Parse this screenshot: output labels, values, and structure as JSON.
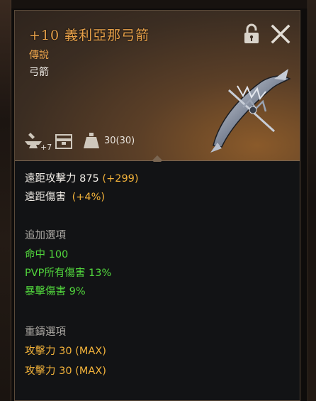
{
  "tooltip": {
    "item_name": "+10  義利亞那弓箭",
    "grade": "傳說",
    "item_type": "弓箭",
    "enhance_count": "+7",
    "weight": "30(30)"
  },
  "stats": {
    "ranged_attack_label": "遠距攻擊力 875",
    "ranged_attack_bonus": "(+299)",
    "ranged_damage_label": "遠距傷害",
    "ranged_damage_bonus": "(+4%)"
  },
  "bonus_options": {
    "header": "追加選項",
    "items": [
      "命中 100",
      "PVP所有傷害 13%",
      "暴擊傷害 9%"
    ]
  },
  "reforge_options": {
    "header": "重鑄選項",
    "items": [
      "攻擊力 30 (MAX)",
      "攻擊力 30 (MAX)"
    ]
  },
  "colors": {
    "name": "#e9a24a",
    "bonus_green": "#52d83d",
    "reforge_gold": "#f2b23a"
  },
  "icons": {
    "lock": "padlock-icon",
    "close": "close-icon",
    "enhance": "anvil-icon",
    "storage": "chest-icon",
    "weight": "weight-icon"
  }
}
